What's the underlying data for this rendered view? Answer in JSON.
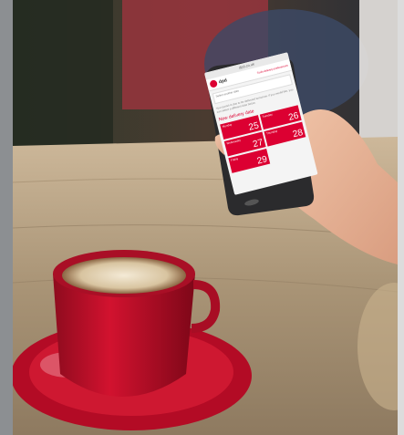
{
  "phone_app": {
    "status_url": "dpd.co.uk",
    "brand": "dpd",
    "header_link": "Tools delivery preferences",
    "address_placeholder": "Select another date",
    "info_text": "Your parcel is due to be delivered tomorrow. If you would like, you can select a different date below.",
    "date_heading": "New delivery date",
    "dates": [
      {
        "day": "Monday",
        "num": "25"
      },
      {
        "day": "Tuesday",
        "num": "26"
      },
      {
        "day": "Wednesday",
        "num": "27"
      },
      {
        "day": "Thursday",
        "num": "28"
      },
      {
        "day": "Friday",
        "num": "29"
      }
    ]
  },
  "colors": {
    "brand_red": "#dc0032",
    "cup_red": "#c8102e",
    "table": "#b9a58a"
  }
}
